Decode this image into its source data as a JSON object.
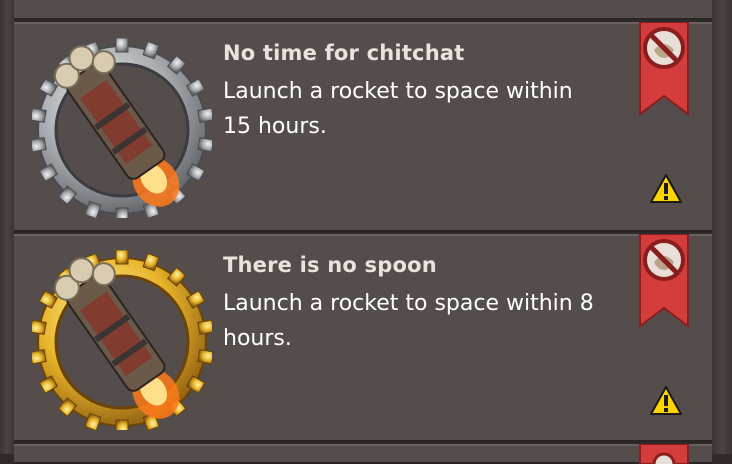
{
  "achievements": [
    {
      "title": "No time for chitchat",
      "description": "Launch a rocket to space within 15 hours.",
      "medal_tier": "silver",
      "medal_color": "#b9bcbf",
      "status_icon": "not-allowed-icon",
      "warning_icon": "warning-icon"
    },
    {
      "title": "There is no spoon",
      "description": "Launch a rocket to space within 8 hours.",
      "medal_tier": "gold",
      "medal_color": "#e8b52a",
      "status_icon": "not-allowed-icon",
      "warning_icon": "warning-icon"
    }
  ],
  "colors": {
    "panel": "#554c4c",
    "ribbon_red": "#d53c3c",
    "warning_yellow": "#ffd400"
  }
}
